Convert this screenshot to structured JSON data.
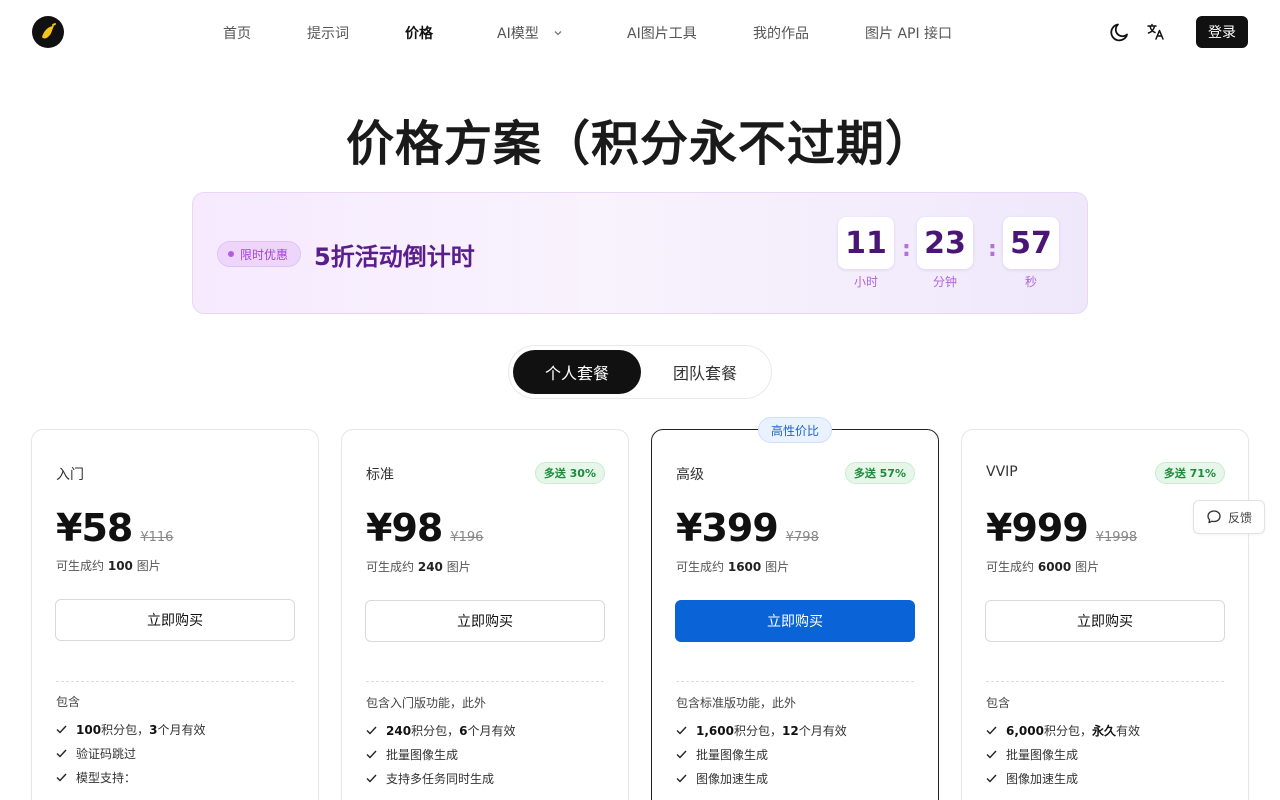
{
  "nav": {
    "items": [
      "首页",
      "提示词",
      "价格",
      "AI模型",
      "AI图片工具",
      "我的作品",
      "图片 API 接口"
    ],
    "active": "价格",
    "login": "登录"
  },
  "title": "价格方案（积分永不过期）",
  "promo": {
    "badge": "限时优惠",
    "text": "5折活动倒计时",
    "hours": "11",
    "minutes": "23",
    "seconds": "57",
    "hours_label": "小时",
    "minutes_label": "分钟",
    "seconds_label": "秒",
    "separator": ":"
  },
  "toggle": [
    "个人套餐",
    "团队套餐"
  ],
  "cards": [
    {
      "name": "入门",
      "bonus": "",
      "price": "¥58",
      "original": "¥116",
      "gen_prefix": "可生成约",
      "gen_count": "100",
      "gen_suffix": "图片",
      "buy": "立即购买",
      "includes": "包含",
      "features": [
        {
          "pre": "",
          "b1": "100",
          "mid": "积分包，",
          "b2": "3",
          "post": " 个月有效"
        },
        {
          "pre": "验证码跳过"
        },
        {
          "pre": "模型支持："
        }
      ]
    },
    {
      "name": "标准",
      "bonus": "多送 30%",
      "price": "¥98",
      "original": "¥196",
      "gen_prefix": "可生成约",
      "gen_count": "240",
      "gen_suffix": "图片",
      "buy": "立即购买",
      "includes": "包含入门版功能，此外",
      "features": [
        {
          "pre": "",
          "b1": "240",
          "mid": "积分包，",
          "b2": "6",
          "post": " 个月有效"
        },
        {
          "pre": "批量图像生成"
        },
        {
          "pre": "支持多任务同时生成"
        }
      ]
    },
    {
      "name": "高级",
      "bonus": "多送 57%",
      "price": "¥399",
      "original": "¥798",
      "gen_prefix": "可生成约",
      "gen_count": "1600",
      "gen_suffix": "图片",
      "buy": "立即购买",
      "includes": "包含标准版功能，此外",
      "tag": "高性价比",
      "features": [
        {
          "pre": "",
          "b1": "1,600",
          "mid": "积分包，",
          "b2": "12",
          "post": " 个月有效"
        },
        {
          "pre": "批量图像生成"
        },
        {
          "pre": "图像加速生成"
        }
      ]
    },
    {
      "name": "VVIP",
      "bonus": "多送 71%",
      "price": "¥999",
      "original": "¥1998",
      "gen_prefix": "可生成约",
      "gen_count": "6000",
      "gen_suffix": "图片",
      "buy": "立即购买",
      "includes": "包含",
      "features": [
        {
          "pre": "",
          "b1": "6,000",
          "mid": "积分包，",
          "b2": "永久",
          "post": "有效"
        },
        {
          "pre": "批量图像生成"
        },
        {
          "pre": "图像加速生成"
        }
      ]
    }
  ],
  "feedback": "反馈",
  "colors": {
    "primary_button": "#0a64d8",
    "bonus_green": "#1f8a3b",
    "promo_purple": "#5a1e8c",
    "dark": "#111111"
  },
  "icons": {
    "logo": "banana-logo-icon",
    "theme": "moon-icon",
    "language": "translate-icon",
    "dropdown": "chevron-down-icon",
    "check": "check-icon",
    "feedback": "chat-bubble-icon"
  }
}
